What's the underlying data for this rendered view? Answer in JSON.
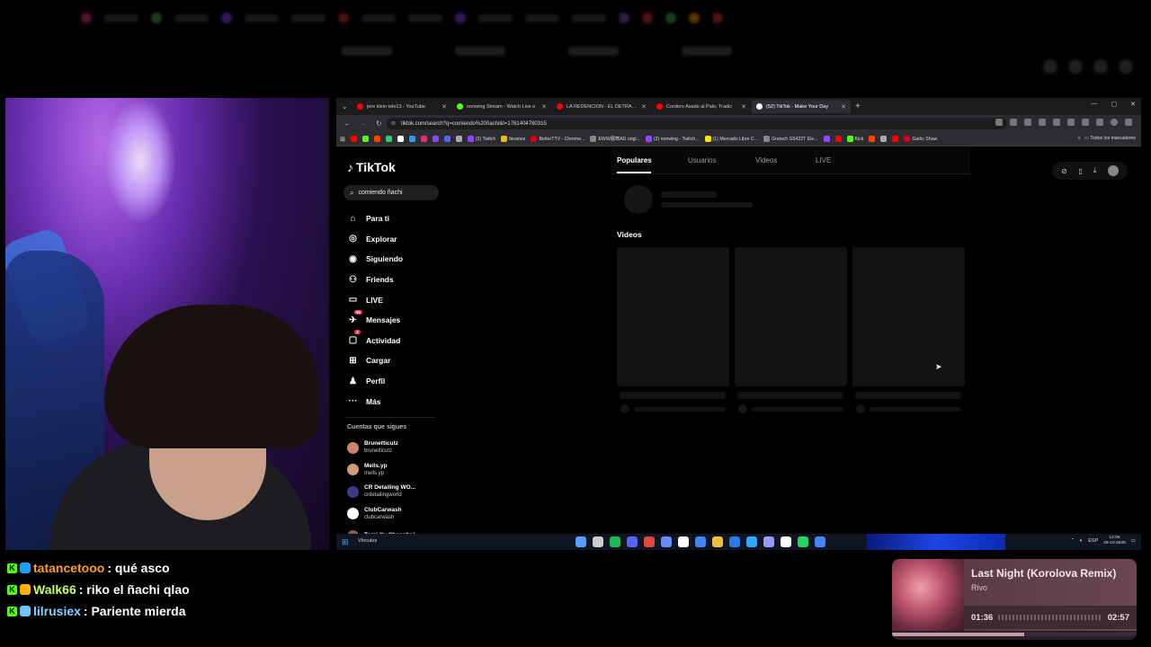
{
  "browser": {
    "tabs": [
      {
        "title": "jere klein tele13 - YouTube",
        "color": "#ff0000",
        "active": false
      },
      {
        "title": "nonwing Stream - Watch Live o",
        "color": "#53fc18",
        "active": false
      },
      {
        "title": "LA REDENCION - EL DETRAS D",
        "color": "#ff0000",
        "active": false
      },
      {
        "title": "Cordero Asado al Palo, Tradic",
        "color": "#ff0000",
        "active": false
      },
      {
        "title": "(52) TikTok - Make Your Day",
        "color": "#ffffff",
        "active": true
      }
    ],
    "url": "tiktok.com/search?q=comiendo%20ñachi&t=1761404780315",
    "bookmarks": [
      {
        "label": "",
        "color": "#ff0000"
      },
      {
        "label": "",
        "color": "#53fc18"
      },
      {
        "label": "",
        "color": "#ff4500"
      },
      {
        "label": "",
        "color": "#25d366"
      },
      {
        "label": "",
        "color": "#ffffff"
      },
      {
        "label": "",
        "color": "#1da1f2"
      },
      {
        "label": "",
        "color": "#e1306c"
      },
      {
        "label": "",
        "color": "#9146ff"
      },
      {
        "label": "",
        "color": "#5865f2"
      },
      {
        "label": "",
        "color": "#aaaaaa"
      },
      {
        "label": "(2) Twitch",
        "color": "#9146ff"
      },
      {
        "label": "binance",
        "color": "#f0b90b"
      },
      {
        "label": "BetterTTV - Chrome...",
        "color": "#d50014"
      },
      {
        "label": "EWW展寒AD origi...",
        "color": "#888888"
      },
      {
        "label": "(2) nonwing - Twitch...",
        "color": "#9146ff"
      },
      {
        "label": "(1) Mercado Libre C...",
        "color": "#ffe600"
      },
      {
        "label": "Gretsch G5422T Ele...",
        "color": "#888888"
      },
      {
        "label": "",
        "color": "#9146ff"
      },
      {
        "label": "",
        "color": "#ff0000"
      },
      {
        "label": "Kick",
        "color": "#53fc18"
      },
      {
        "label": "",
        "color": "#ff4500"
      },
      {
        "label": "",
        "color": "#aaaaaa"
      },
      {
        "label": "",
        "color": "#ff0000"
      },
      {
        "label": "Garlic Show",
        "color": "#d50014"
      }
    ],
    "all_bookmarks": "Todos los marcadores"
  },
  "tiktok": {
    "logo": "TikTok",
    "search_value": "comiendo ñachi",
    "nav": [
      {
        "label": "Para ti",
        "icon": "⌂",
        "badge": ""
      },
      {
        "label": "Explorar",
        "icon": "◎",
        "badge": ""
      },
      {
        "label": "Siguiendo",
        "icon": "◉",
        "badge": ""
      },
      {
        "label": "Friends",
        "icon": "⚇",
        "badge": ""
      },
      {
        "label": "LIVE",
        "icon": "▭",
        "badge": ""
      },
      {
        "label": "Mensajes",
        "icon": "✈",
        "badge": "56"
      },
      {
        "label": "Actividad",
        "icon": "▢",
        "badge": "3"
      },
      {
        "label": "Cargar",
        "icon": "⊞",
        "badge": ""
      },
      {
        "label": "Perfil",
        "icon": "♟",
        "badge": ""
      },
      {
        "label": "Más",
        "icon": "···",
        "badge": ""
      }
    ],
    "following_title": "Cuentas que sigues",
    "following": [
      {
        "name": "Brunetticutz",
        "handle": "brunetticutz",
        "color": "#c9856b"
      },
      {
        "name": "Mells.yp",
        "handle": "mells.yp",
        "color": "#d29a7a"
      },
      {
        "name": "CR Detailing WO...",
        "handle": "crdetailingworld",
        "color": "#3b3b8a"
      },
      {
        "name": "ClubCarwash",
        "handle": "clubcarwash",
        "color": "#ffffff"
      },
      {
        "name": "Tomi Xu Shanghai",
        "handle": "",
        "color": "#8a5a4a"
      }
    ],
    "results_tabs": [
      "Populares",
      "Usuarios",
      "Videos",
      "LIVE"
    ],
    "videos_heading": "Videos"
  },
  "taskbar": {
    "label": "Vínculos",
    "lang": "ESP",
    "time": "12:06",
    "date": "25-10-2025",
    "apps": [
      "#55a0ff",
      "#cccccc",
      "#1db954",
      "#5865f2",
      "#e04a3a",
      "#6a8cff",
      "#ffffff",
      "#4285f4",
      "#f0c040",
      "#2c7be5",
      "#31a8ff",
      "#9999ff",
      "#ffffff",
      "#25d366",
      "#4285f4"
    ]
  },
  "chat": [
    {
      "user": "tatancetooo",
      "user_color": "#ff9f1c",
      "badge_color": "#1da1f2",
      "message": ": qué asco"
    },
    {
      "user": "Walk66",
      "user_color": "#c6ff6b",
      "badge_color": "#ffb000",
      "message": ": riko el ñachi qlao"
    },
    {
      "user": "lilrusiex",
      "user_color": "#7fd6ff",
      "badge_color": "#6ec6ff",
      "message": ": Pariente mierda"
    }
  ],
  "music": {
    "title": "Last Night (Korolova Remix)",
    "artist": "Rivo",
    "current": "01:36",
    "total": "02:57",
    "progress": 0.54
  }
}
